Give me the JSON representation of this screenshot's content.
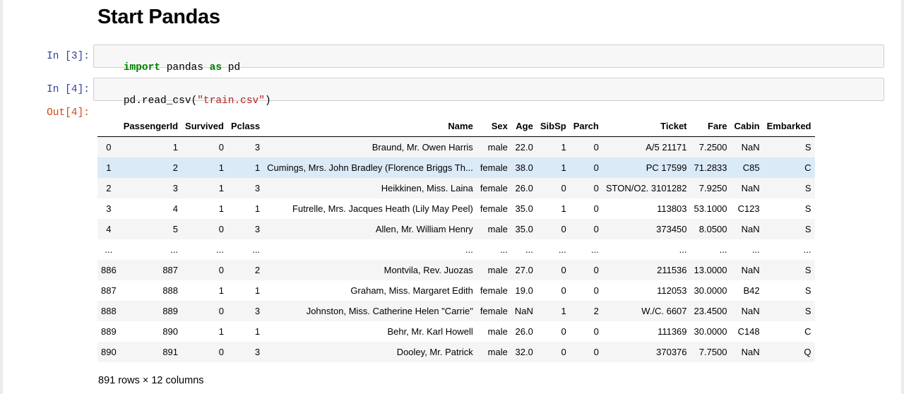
{
  "heading": "Start Pandas",
  "cells": [
    {
      "prompt": "In [3]:",
      "code": [
        {
          "text": "import",
          "cls": "kw"
        },
        {
          "text": " pandas ",
          "cls": ""
        },
        {
          "text": "as",
          "cls": "kw"
        },
        {
          "text": " pd",
          "cls": ""
        }
      ]
    },
    {
      "prompt": "In [4]:",
      "code": [
        {
          "text": "pd.read_csv(",
          "cls": ""
        },
        {
          "text": "\"train.csv\"",
          "cls": "str"
        },
        {
          "text": ")",
          "cls": ""
        }
      ]
    }
  ],
  "output": {
    "prompt": "Out[4]:",
    "table": {
      "index_header": "",
      "columns": [
        "PassengerId",
        "Survived",
        "Pclass",
        "Name",
        "Sex",
        "Age",
        "SibSp",
        "Parch",
        "Ticket",
        "Fare",
        "Cabin",
        "Embarked"
      ],
      "rows": [
        {
          "index": "0",
          "cells": [
            "1",
            "0",
            "3",
            "Braund, Mr. Owen Harris",
            "male",
            "22.0",
            "1",
            "0",
            "A/5 21171",
            "7.2500",
            "NaN",
            "S"
          ]
        },
        {
          "index": "1",
          "cells": [
            "2",
            "1",
            "1",
            "Cumings, Mrs. John Bradley (Florence Briggs Th...",
            "female",
            "38.0",
            "1",
            "0",
            "PC 17599",
            "71.2833",
            "C85",
            "C"
          ],
          "highlighted": true
        },
        {
          "index": "2",
          "cells": [
            "3",
            "1",
            "3",
            "Heikkinen, Miss. Laina",
            "female",
            "26.0",
            "0",
            "0",
            "STON/O2. 3101282",
            "7.9250",
            "NaN",
            "S"
          ]
        },
        {
          "index": "3",
          "cells": [
            "4",
            "1",
            "1",
            "Futrelle, Mrs. Jacques Heath (Lily May Peel)",
            "female",
            "35.0",
            "1",
            "0",
            "113803",
            "53.1000",
            "C123",
            "S"
          ]
        },
        {
          "index": "4",
          "cells": [
            "5",
            "0",
            "3",
            "Allen, Mr. William Henry",
            "male",
            "35.0",
            "0",
            "0",
            "373450",
            "8.0500",
            "NaN",
            "S"
          ]
        },
        {
          "index": "...",
          "cells": [
            "...",
            "...",
            "...",
            "...",
            "...",
            "...",
            "...",
            "...",
            "...",
            "...",
            "...",
            "..."
          ]
        },
        {
          "index": "886",
          "cells": [
            "887",
            "0",
            "2",
            "Montvila, Rev. Juozas",
            "male",
            "27.0",
            "0",
            "0",
            "211536",
            "13.0000",
            "NaN",
            "S"
          ]
        },
        {
          "index": "887",
          "cells": [
            "888",
            "1",
            "1",
            "Graham, Miss. Margaret Edith",
            "female",
            "19.0",
            "0",
            "0",
            "112053",
            "30.0000",
            "B42",
            "S"
          ]
        },
        {
          "index": "888",
          "cells": [
            "889",
            "0",
            "3",
            "Johnston, Miss. Catherine Helen \"Carrie\"",
            "female",
            "NaN",
            "1",
            "2",
            "W./C. 6607",
            "23.4500",
            "NaN",
            "S"
          ]
        },
        {
          "index": "889",
          "cells": [
            "890",
            "1",
            "1",
            "Behr, Mr. Karl Howell",
            "male",
            "26.0",
            "0",
            "0",
            "111369",
            "30.0000",
            "C148",
            "C"
          ]
        },
        {
          "index": "890",
          "cells": [
            "891",
            "0",
            "3",
            "Dooley, Mr. Patrick",
            "male",
            "32.0",
            "0",
            "0",
            "370376",
            "7.7500",
            "NaN",
            "Q"
          ]
        }
      ]
    },
    "summary": "891 rows × 12 columns"
  },
  "colors": {
    "input_prompt": "#303f9f",
    "output_prompt": "#d84315",
    "keyword": "#008000",
    "string": "#ba2121",
    "row_highlight": "#dbeaf7"
  }
}
